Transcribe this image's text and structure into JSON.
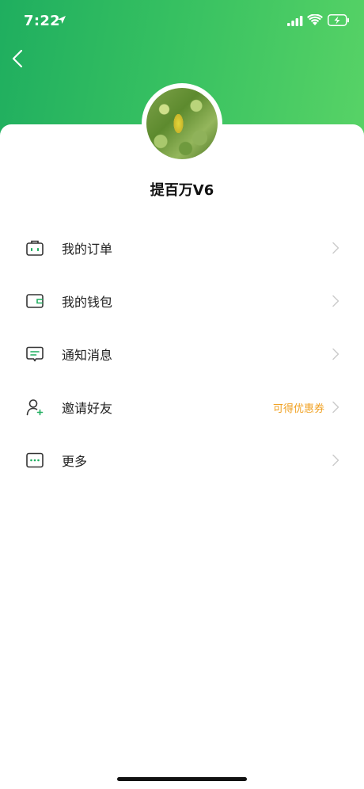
{
  "status_bar": {
    "time": "7:22"
  },
  "profile": {
    "username": "提百万V6"
  },
  "menu": {
    "items": [
      {
        "label": "我的订单",
        "icon": "briefcase-icon",
        "hint": ""
      },
      {
        "label": "我的钱包",
        "icon": "wallet-icon",
        "hint": ""
      },
      {
        "label": "通知消息",
        "icon": "message-icon",
        "hint": ""
      },
      {
        "label": "邀请好友",
        "icon": "add-user-icon",
        "hint": "可得优惠券"
      },
      {
        "label": "更多",
        "icon": "more-icon",
        "hint": ""
      }
    ]
  },
  "colors": {
    "header_gradient_start": "#1fae5f",
    "header_gradient_end": "#58d366",
    "icon_accent": "#1fae5f",
    "hint_color": "#f0a020"
  }
}
